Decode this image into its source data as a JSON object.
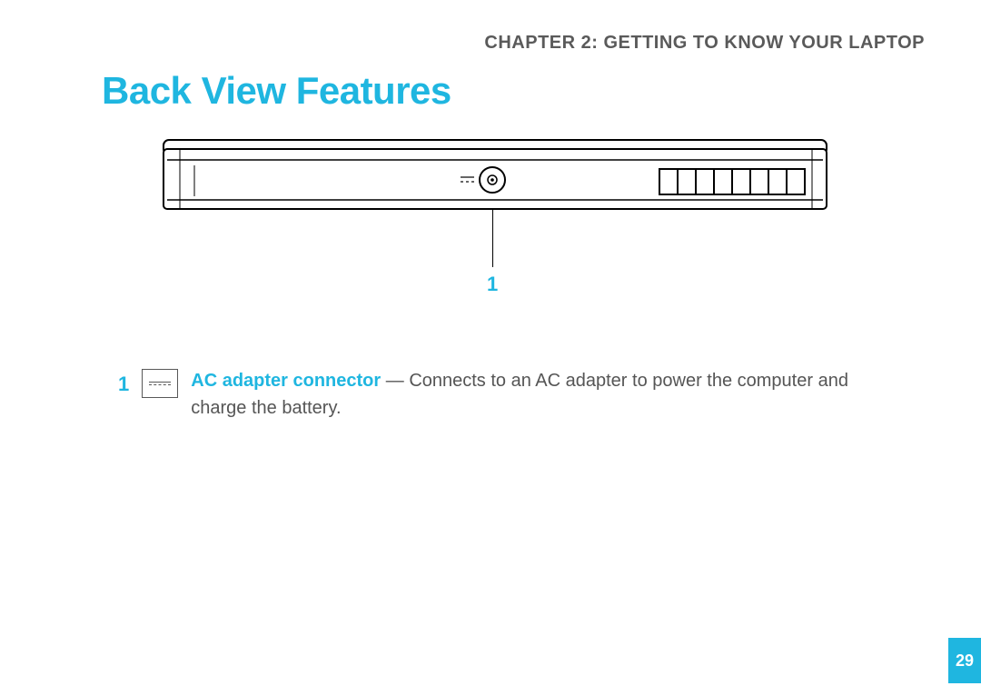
{
  "chapter_header": "CHAPTER 2: GETTING TO KNOW YOUR LAPTOP",
  "section_title": "Back View Features",
  "diagram": {
    "callout_number": "1"
  },
  "legend": {
    "items": [
      {
        "number": "1",
        "term": "AC adapter connector",
        "separator": " — ",
        "description": "Connects to an AC adapter to power the computer and charge the battery."
      }
    ]
  },
  "page_number": "29",
  "colors": {
    "accent": "#1fb6e0",
    "body_text": "#555555",
    "header_text": "#5a5a5a"
  }
}
